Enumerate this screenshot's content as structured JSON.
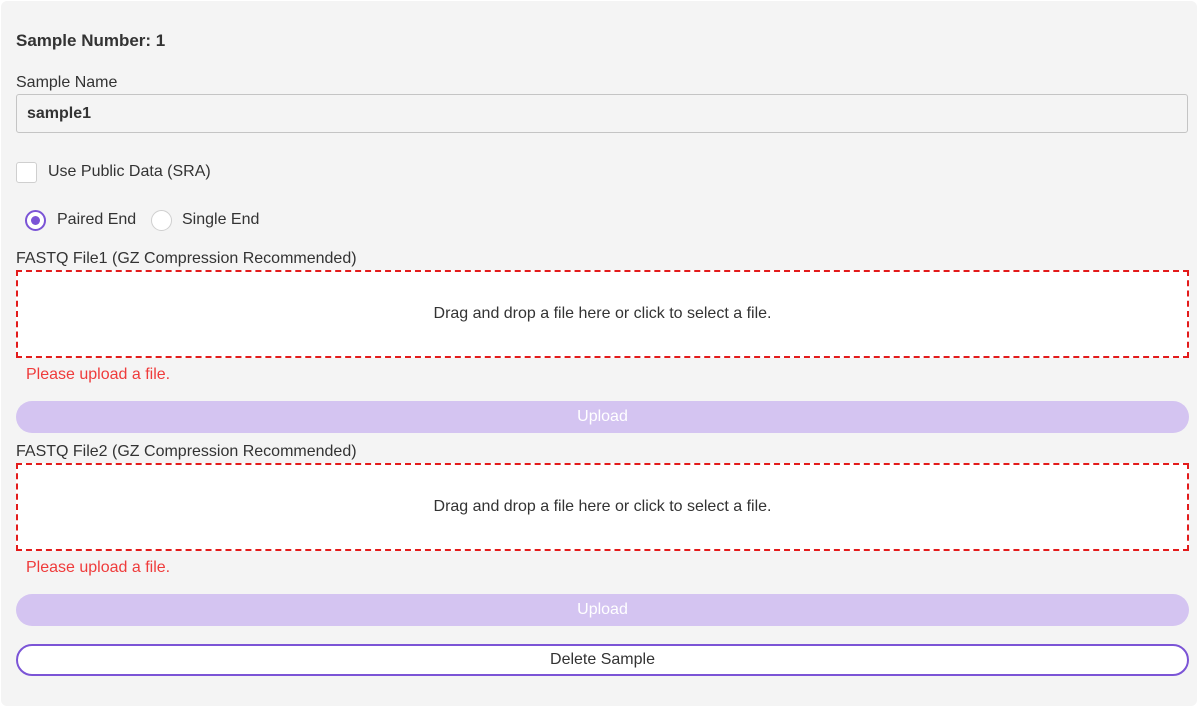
{
  "sample": {
    "number_text": "Sample Number: 1",
    "name_label": "Sample Name",
    "name_value": "sample1"
  },
  "public_data": {
    "label": "Use Public Data (SRA)",
    "checked": false
  },
  "read_type": {
    "options": [
      {
        "label": "Paired End",
        "selected": true
      },
      {
        "label": "Single End",
        "selected": false
      }
    ]
  },
  "files": [
    {
      "label": "FASTQ File1 (GZ Compression Recommended)",
      "dropzone_text": "Drag and drop a file here or click to select a file.",
      "error": "Please upload a file.",
      "upload_label": "Upload"
    },
    {
      "label": "FASTQ File2 (GZ Compression Recommended)",
      "dropzone_text": "Drag and drop a file here or click to select a file.",
      "error": "Please upload a file.",
      "upload_label": "Upload"
    }
  ],
  "delete_label": "Delete Sample",
  "colors": {
    "accent": "#7b54d6",
    "upload_disabled": "#d4c4f1",
    "error": "#ef3b3b",
    "dropzone_border": "#e31b1b",
    "panel_bg": "#f4f4f4"
  }
}
